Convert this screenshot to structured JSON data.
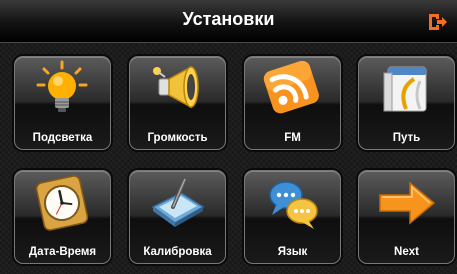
{
  "header": {
    "title": "Установки",
    "exit_icon": "exit-door-icon",
    "accent_color": "#f37021"
  },
  "tiles": [
    {
      "label": "Подсветка",
      "icon": "lightbulb-icon"
    },
    {
      "label": "Громкость",
      "icon": "megaphone-icon"
    },
    {
      "label": "FM",
      "icon": "rss-broadcast-icon"
    },
    {
      "label": "Путь",
      "icon": "folder-path-icon"
    },
    {
      "label": "Дата-Время",
      "icon": "clock-icon"
    },
    {
      "label": "Калибровка",
      "icon": "stylus-tablet-icon"
    },
    {
      "label": "Язык",
      "icon": "chat-bubbles-icon"
    },
    {
      "label": "Next",
      "icon": "arrow-right-icon"
    }
  ]
}
